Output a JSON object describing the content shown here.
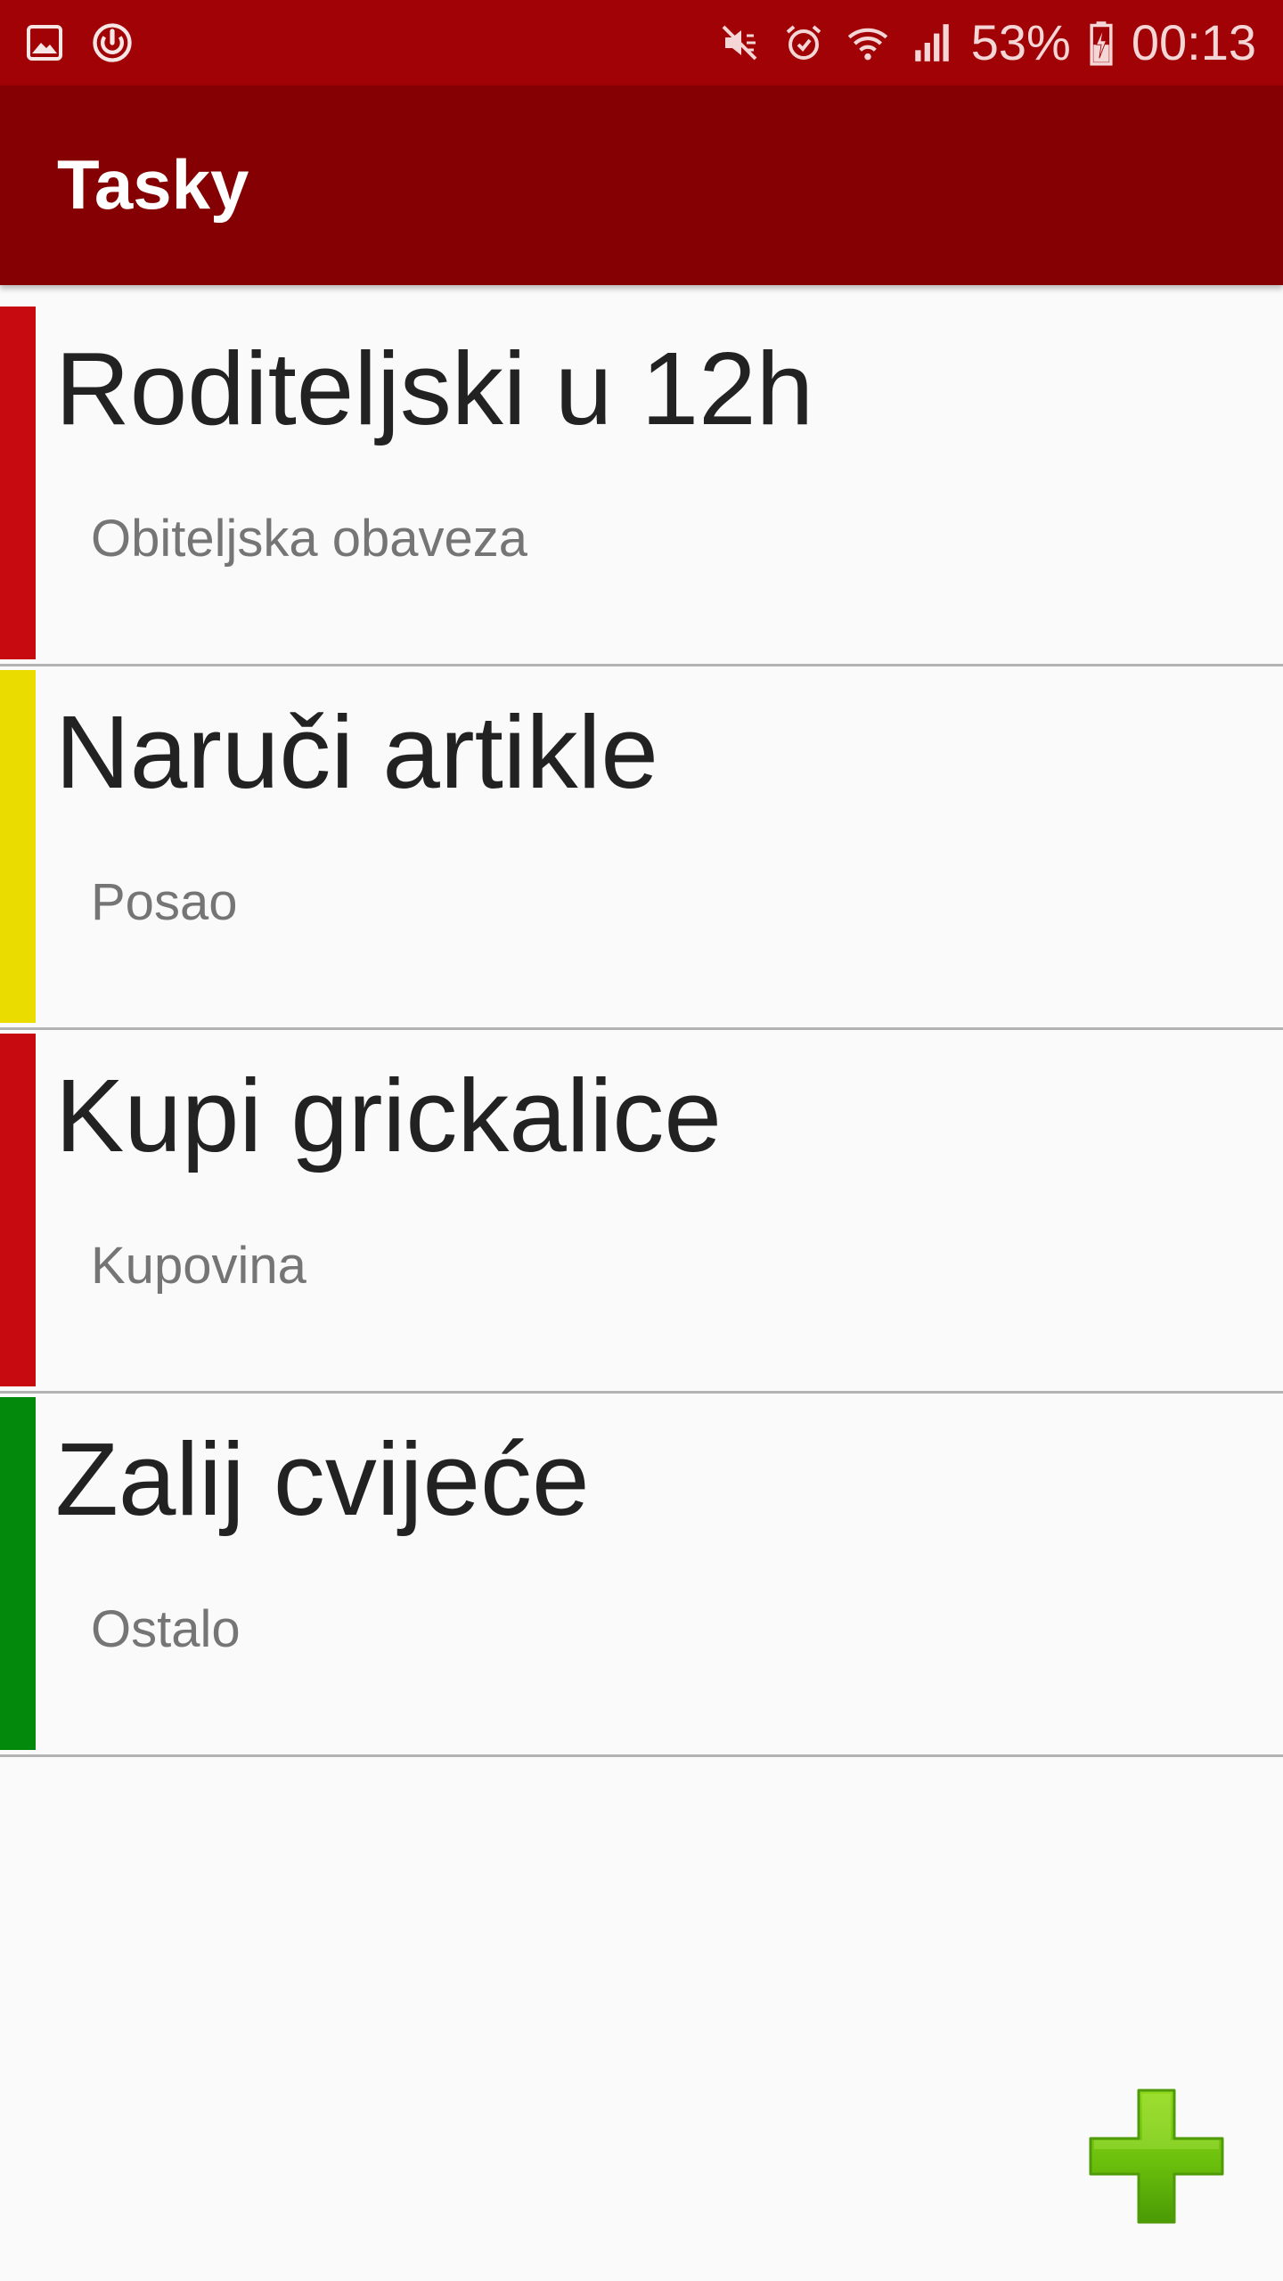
{
  "status_bar": {
    "battery": "53%",
    "time": "00:13",
    "left_icons": [
      "image-icon",
      "sync-icon"
    ],
    "right_icons": [
      "mute-icon",
      "alarm-icon",
      "wifi-icon",
      "signal-icon",
      "battery-charging-icon"
    ]
  },
  "app_bar": {
    "title": "Tasky",
    "background": "#850002"
  },
  "tasks": [
    {
      "title": "Roditeljski u 12h",
      "category": "Obiteljska obaveza",
      "priority_color": "#c70a0f"
    },
    {
      "title": "Naruči artikle",
      "category": "Posao",
      "priority_color": "#ebdc00"
    },
    {
      "title": "Kupi grickalice",
      "category": "Kupovina",
      "priority_color": "#c70a0f"
    },
    {
      "title": "Zalij cvijeće",
      "category": "Ostalo",
      "priority_color": "#038a0d"
    }
  ],
  "fab": {
    "icon": "plus-icon",
    "color": "#6bbf0c"
  }
}
